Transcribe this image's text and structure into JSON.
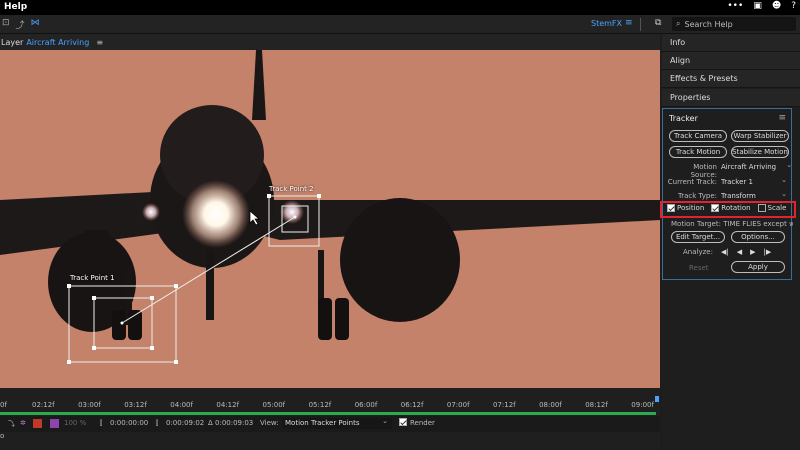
{
  "menubar": {
    "help": "Help"
  },
  "toolbar": {
    "workspace": "StemFX",
    "search_placeholder": "Search Help"
  },
  "layer_tab": {
    "label": "Layer",
    "name": "Aircraft Arriving"
  },
  "viewer": {
    "track_point_1": "Track Point 1",
    "track_point_2": "Track Point 2"
  },
  "timeline": {
    "ticks": [
      "0f",
      "02:12f",
      "03:00f",
      "03:12f",
      "04:00f",
      "04:12f",
      "05:00f",
      "05:12f",
      "06:00f",
      "06:12f",
      "07:00f",
      "07:12f",
      "08:00f",
      "08:12f",
      "09:00f"
    ],
    "zoom": "100 %",
    "time_in": "0:00:00:00",
    "time_out": "0:00:09:02",
    "duration": "Δ 0:00:09:03",
    "view_label": "View:",
    "view_value": "Motion Tracker Points",
    "render_label": "Render"
  },
  "panels": {
    "info": "Info",
    "align": "Align",
    "effects": "Effects & Presets",
    "properties": "Properties"
  },
  "tracker": {
    "title": "Tracker",
    "track_camera": "Track Camera",
    "warp_stabilizer": "Warp Stabilizer",
    "track_motion": "Track Motion",
    "stabilize_motion": "Stabilize Motion",
    "motion_source_label": "Motion Source:",
    "motion_source": "Aircraft Arriving",
    "current_track_label": "Current Track:",
    "current_track": "Tracker 1",
    "track_type_label": "Track Type:",
    "track_type": "Transform",
    "position": "Position",
    "rotation": "Rotation",
    "scale": "Scale",
    "motion_target": "Motion Target: TIME FLIES except wher",
    "edit_target": "Edit Target...",
    "options": "Options...",
    "analyze_label": "Analyze:",
    "reset": "Reset",
    "apply": "Apply"
  }
}
